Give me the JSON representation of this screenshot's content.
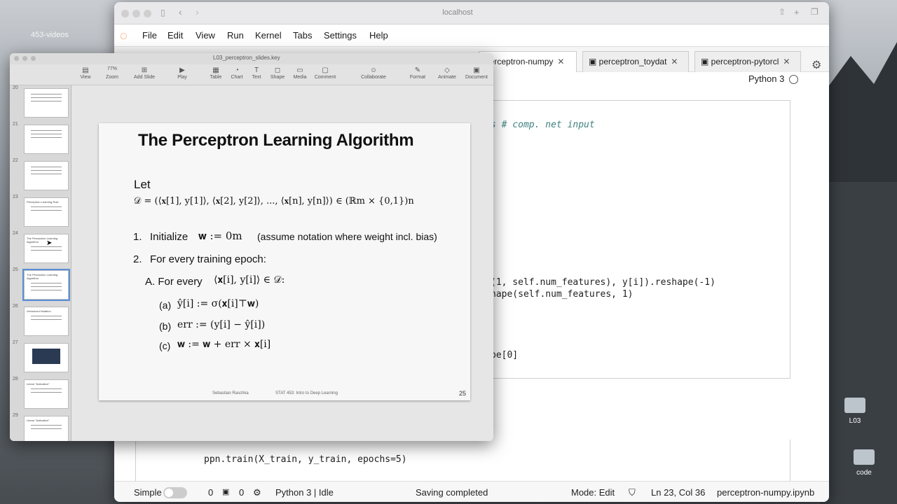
{
  "desktop": {
    "left_title": "453-videos",
    "folders": [
      "L03",
      "code"
    ]
  },
  "browser": {
    "url": "localhost",
    "menu": [
      "File",
      "Edit",
      "View",
      "Run",
      "Kernel",
      "Tabs",
      "Settings",
      "Help"
    ],
    "tabs": [
      {
        "label": "perceptron-numpy",
        "active": true
      },
      {
        "label": "perceptron_toydat",
        "active": false
      },
      {
        "label": "perceptron-pytorcl",
        "active": false
      }
    ],
    "kernel": "Python 3",
    "code_lines": [
      {
        "text": "s # comp. net input",
        "comment": true
      },
      {
        "text": "(1, self.num_features), y[i]).reshape(-1)",
        "comment": false
      },
      {
        "text": "hape(self.num_features, 1)",
        "comment": false
      },
      {
        "text": "pe[0]",
        "comment": false
      }
    ],
    "train_line": "ppn.train(X_train, y_train, epochs=5)",
    "status": {
      "mode_label": "Simple",
      "count_a": "0",
      "count_b": "0",
      "kernel_status": "Python 3 | Idle",
      "saving": "Saving completed",
      "edit_mode": "Mode: Edit",
      "cursor_pos": "Ln 23, Col 36",
      "filename": "perceptron-numpy.ipynb"
    }
  },
  "keynote": {
    "filename": "L03_perceptron_slides.key",
    "toolbar": [
      "View",
      "Zoom",
      "Add Slide",
      "Play",
      "Table",
      "Chart",
      "Text",
      "Shape",
      "Media",
      "Comment",
      "Collaborate",
      "Format",
      "Animate",
      "Document"
    ],
    "zoom": "77%",
    "slide_numbers": [
      "20",
      "21",
      "22",
      "23",
      "24",
      "25",
      "26",
      "27",
      "28",
      "29"
    ],
    "thumb_titles": [
      "",
      "",
      "",
      "Perceptron Learning Rule",
      "The Perceptron Learning Algorithm",
      "The Perceptron Learning Algorithm",
      "Vectorized Notation",
      "",
      "Linear \"Activation\"",
      "Linear \"Activation\""
    ],
    "selected_index": 5
  },
  "slide": {
    "title": "The Perceptron Learning Algorithm",
    "let": "Let",
    "dataset": "𝒟 = (⟨𝐱[1], y[1]⟩, ⟨𝐱[2], y[2]⟩, ..., ⟨𝐱[n], y[n]⟩) ∈ (ℝm × {0,1})n",
    "step1_num": "1.",
    "step1_label": "Initialize",
    "step1_math": "𝐰 := 0m",
    "step1_note": "(assume notation where weight incl. bias)",
    "step2_num": "2.",
    "step2_label": "For every training epoch:",
    "stepA_label": "A.  For every",
    "stepA_math": "⟨𝐱[i], y[i]⟩ ∈ 𝒟:",
    "sub_a": "(a)",
    "sub_a_math": "ŷ[i] := σ(𝐱[i]⊤𝐰)",
    "sub_b": "(b)",
    "sub_b_math": "err := (y[i] − ŷ[i])",
    "sub_c": "(c)",
    "sub_c_math": "𝐰 := 𝐰 + err × 𝐱[i]",
    "footer_author": "Sebastian Raschka",
    "footer_course": "STAT 453: Intro to Deep Learning",
    "page": "25"
  }
}
